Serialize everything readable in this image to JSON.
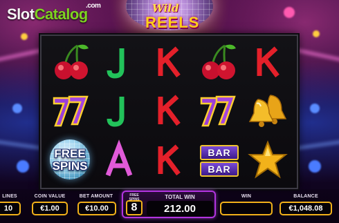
{
  "branding": {
    "watermark_part1": "Slot",
    "watermark_part2": "Catalog",
    "watermark_suffix": ".com",
    "game_title_top": "Wild",
    "game_title_bottom": "REELS"
  },
  "reels": {
    "grid": [
      [
        "cherries",
        "J",
        "K",
        "cherries",
        "K"
      ],
      [
        "seven",
        "J",
        "K",
        "seven",
        "bells"
      ],
      [
        "free-spins",
        "A",
        "K",
        "bar",
        "star"
      ]
    ],
    "free_spins_symbol_line1": "FREE",
    "free_spins_symbol_line2": "SPINS",
    "bar_symbol_label": "BAR",
    "letter_colors": {
      "J": "#22c25a",
      "A": "#e05ad8",
      "K": "#e4202a"
    }
  },
  "hud": {
    "lines_label": "LINES",
    "lines_value": "10",
    "coin_value_label": "COIN VALUE",
    "coin_value": "€1.00",
    "bet_amount_label": "BET AMOUNT",
    "bet_amount": "€10.00",
    "free_spins_label_line1": "FREE",
    "free_spins_label_line2": "SPINS",
    "free_spins_value": "8",
    "total_win_label": "TOTAL WIN",
    "total_win_value": "212.00",
    "win_label": "WIN",
    "win_value": "",
    "balance_label": "BALANCE",
    "balance_value": "€1,048.08"
  },
  "colors": {
    "hud_accent": "#f2b21a",
    "free_spins_panel": "#b234e0",
    "watermark_green": "#7ed321"
  }
}
